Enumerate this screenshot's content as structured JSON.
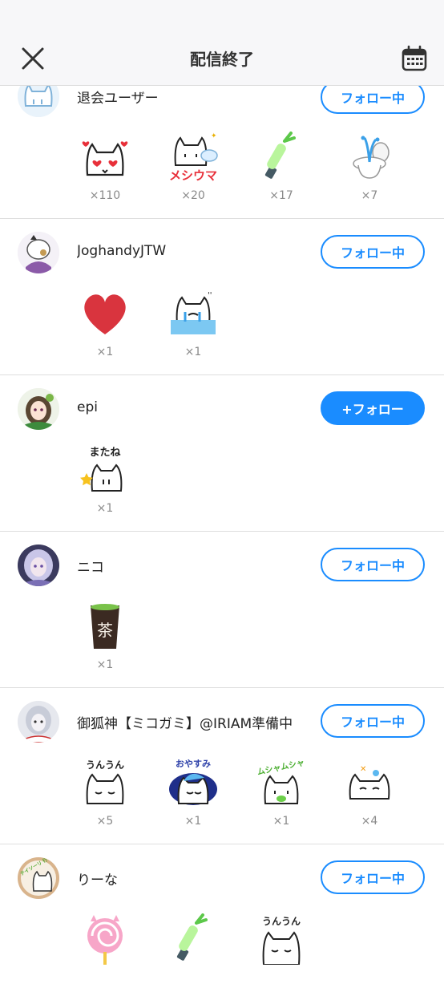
{
  "header": {
    "title": "配信終了",
    "close_icon": "close-icon",
    "calendar_icon": "calendar-icon"
  },
  "colors": {
    "accent": "#1a8cff",
    "divider": "#dedede",
    "count": "#8a8a8a"
  },
  "rows": [
    {
      "username": "退会ユーザー",
      "follow_label": "フォロー中",
      "gifts": [
        {
          "icon": "heart-eyes-cat-sticker",
          "count": "×110"
        },
        {
          "icon": "meshiuma-cat-sticker",
          "text": "メシウマ",
          "count": "×20"
        },
        {
          "icon": "green-onion-lightstick-sticker",
          "count": "×17"
        },
        {
          "icon": "toilet-fountain-sticker",
          "count": "×7"
        }
      ]
    },
    {
      "username": "JoghandyJTW",
      "follow_label": "フォロー中",
      "gifts": [
        {
          "icon": "red-heart-sticker",
          "count": "×1"
        },
        {
          "icon": "crying-cat-sticker",
          "count": "×1"
        }
      ]
    },
    {
      "username": "epi",
      "follow_label": "+フォロー",
      "gifts": [
        {
          "icon": "matane-cat-sticker",
          "text": "またね",
          "count": "×1"
        }
      ]
    },
    {
      "username": "ニコ",
      "follow_label": "フォロー中",
      "gifts": [
        {
          "icon": "green-tea-cup-sticker",
          "text": "茶",
          "count": "×1"
        }
      ]
    },
    {
      "username": "御狐神【ミコガミ】@IRIAM準備中",
      "follow_label": "フォロー中",
      "gifts": [
        {
          "icon": "unun-cat-sticker",
          "text": "うんうん",
          "count": "×5"
        },
        {
          "icon": "oyasumi-cat-sticker",
          "text": "おやすみ",
          "count": "×1"
        },
        {
          "icon": "mushamusha-cat-sticker",
          "text": "ムシャムシャ",
          "count": "×1"
        },
        {
          "icon": "sleepy-cat-sticker",
          "count": "×4"
        }
      ]
    },
    {
      "username": "りーな",
      "follow_label": "フォロー中",
      "avatar_text": "テイソーリ 行きます",
      "gifts": [
        {
          "icon": "lollipop-sticker",
          "count": ""
        },
        {
          "icon": "green-onion-lightstick-sticker",
          "count": ""
        },
        {
          "icon": "unun-cat-sticker",
          "text": "うんうん",
          "count": ""
        }
      ]
    }
  ]
}
